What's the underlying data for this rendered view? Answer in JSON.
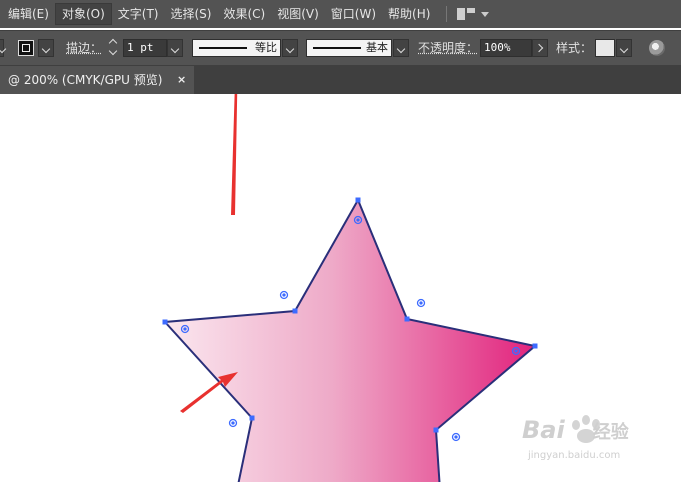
{
  "menu": {
    "items": [
      {
        "label": "编辑(E)",
        "active": false
      },
      {
        "label": "对象(O)",
        "active": true
      },
      {
        "label": "文字(T)",
        "active": false
      },
      {
        "label": "选择(S)",
        "active": false
      },
      {
        "label": "效果(C)",
        "active": false
      },
      {
        "label": "视图(V)",
        "active": false
      },
      {
        "label": "窗口(W)",
        "active": false
      },
      {
        "label": "帮助(H)",
        "active": false
      }
    ],
    "workspace_icon": "workspace-layout-icon"
  },
  "control_bar": {
    "stroke_label": "描边：",
    "stroke_weight": "1 pt",
    "variable_width_label": "等比",
    "brush_label": "基本",
    "opacity_label": "不透明度：",
    "opacity_value": "100%",
    "style_label": "样式："
  },
  "document_tab": {
    "title": "@ 200% (CMYK/GPU 预览)",
    "close_glyph": "×"
  },
  "canvas": {
    "shape": "star",
    "gradient": {
      "start": "#fbe7ef",
      "end": "#e2237d"
    },
    "anchor_color": "#3d6bff",
    "annotation_color": "#e8312f"
  },
  "watermark": {
    "brand": "Bai",
    "brand_suffix": "经验",
    "url": "jingyan.baidu.com"
  }
}
